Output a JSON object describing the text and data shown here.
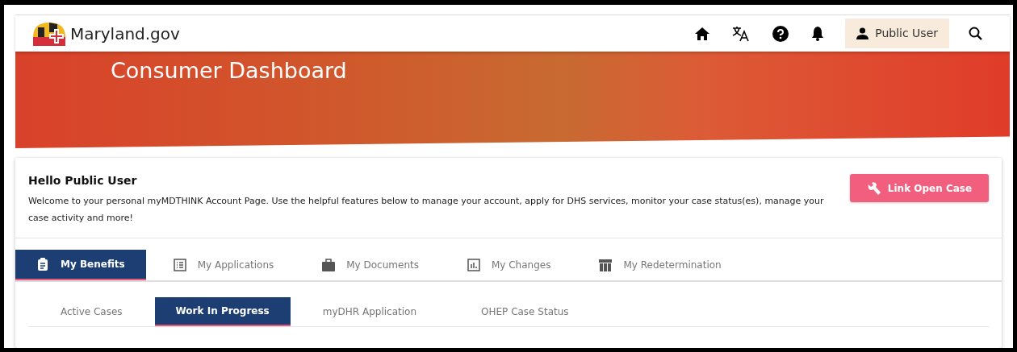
{
  "header": {
    "logo_text": "Maryland.gov",
    "user_button": "Public User"
  },
  "banner": {
    "title": "Consumer Dashboard"
  },
  "welcome": {
    "heading": "Hello Public User",
    "message": "Welcome to your personal myMDTHINK Account Page. Use the helpful features below to manage your account, apply for DHS services, monitor your case status(es), manage your case activity and more!",
    "action_button": "Link Open Case"
  },
  "tabs": [
    {
      "label": "My Benefits",
      "selected": true
    },
    {
      "label": "My Applications",
      "selected": false
    },
    {
      "label": "My Documents",
      "selected": false
    },
    {
      "label": "My Changes",
      "selected": false
    },
    {
      "label": "My Redetermination",
      "selected": false
    }
  ],
  "subtabs": [
    {
      "label": "Active Cases",
      "selected": false
    },
    {
      "label": "Work In Progress",
      "selected": true
    },
    {
      "label": "myDHR Application",
      "selected": false
    },
    {
      "label": "OHEP Case Status",
      "selected": false
    }
  ]
}
